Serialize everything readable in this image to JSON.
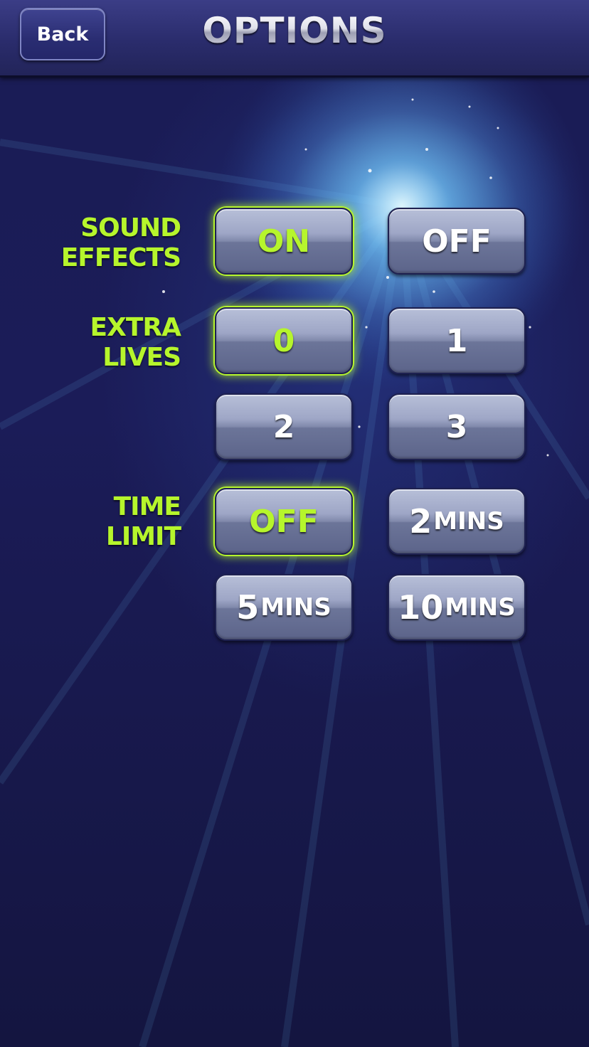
{
  "header": {
    "back_label": "Back",
    "title": "OPTIONS"
  },
  "colors": {
    "accent_selected": "#b6f52c",
    "background": "#1a1c55",
    "button_face": "#9ea6c6"
  },
  "sound_effects": {
    "label": "SOUND\nEFFECTS",
    "options": [
      "ON",
      "OFF"
    ],
    "selected": "ON"
  },
  "extra_lives": {
    "label": "EXTRA\nLIVES",
    "options": [
      "0",
      "1",
      "2",
      "3"
    ],
    "selected": "0"
  },
  "time_limit": {
    "label": "TIME\nLIMIT",
    "selected": "OFF",
    "off_label": "OFF",
    "options": [
      {
        "num": "2",
        "unit": "MINS"
      },
      {
        "num": "5",
        "unit": "MINS"
      },
      {
        "num": "10",
        "unit": "MINS"
      }
    ]
  }
}
